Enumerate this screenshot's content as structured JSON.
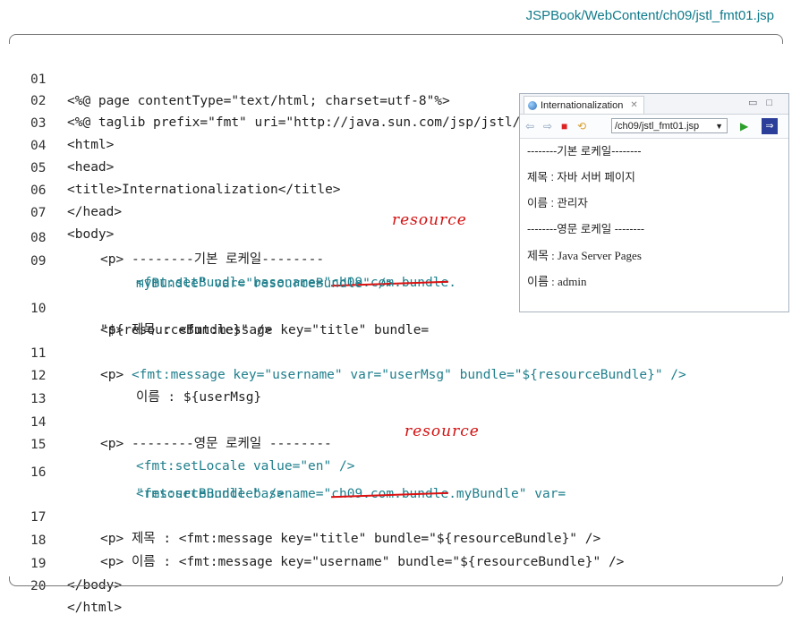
{
  "file_title": "JSPBook/WebContent/ch09/jstl_fmt01.jsp",
  "lines": [
    {
      "num": "01",
      "text": "<%@ page contentType=\"text/html; charset=utf-8\"%>"
    },
    {
      "num": "02",
      "text": "<%@ taglib prefix=\"fmt\" uri=\"http://java.sun.com/jsp/jstl/fmt\"%>"
    },
    {
      "num": "03",
      "text": "<html>"
    },
    {
      "num": "04",
      "text": "<head>"
    },
    {
      "num": "05",
      "text": "<title>Internationalization</title>"
    },
    {
      "num": "06",
      "text": "</head>"
    },
    {
      "num": "07",
      "text": "<body>"
    },
    {
      "num": "08",
      "mark": "<p>",
      "text": "--------기본 로케일--------"
    },
    {
      "num": "09",
      "pre": "<fmt:setBundle basename=\"",
      "strike": "ch09.com.bundle",
      "post": ".",
      "cont": "myBundle\" var=\"resourceBundle\" />"
    },
    {
      "num": "10",
      "mark": "<p>",
      "text": "제목 : <fmt:message key=\"title\" bundle=",
      "cont": "\"${resourceBundle}\" />"
    },
    {
      "num": "11",
      "mark": "<p>",
      "text": "<fmt:message key=\"username\" var=\"userMsg\" bundle=\"${resourceBundle}\" />"
    },
    {
      "num": "12",
      "text": "이름 : ${userMsg}"
    },
    {
      "num": "13",
      "text": ""
    },
    {
      "num": "14",
      "mark": "<p>",
      "text": "--------영문 로케일 --------"
    },
    {
      "num": "15",
      "text": "<fmt:setLocale value=\"en\" />"
    },
    {
      "num": "16",
      "pre": "<fmt:setBundle basename=\"",
      "strike": "ch09.com.bundle",
      "post": ".myBundle\" var=",
      "cont": "\"resourceBundle\" />"
    },
    {
      "num": "17",
      "mark": "<p>",
      "text": "제목 : <fmt:message key=\"title\" bundle=\"${resourceBundle}\" />"
    },
    {
      "num": "18",
      "mark": "<p>",
      "text": "이름 : <fmt:message key=\"username\" bundle=\"${resourceBundle}\" />"
    },
    {
      "num": "19",
      "text": "</body>"
    },
    {
      "num": "20",
      "text": "</html>"
    }
  ],
  "annotations": [
    "resource",
    "resource"
  ],
  "browser": {
    "tab_title": "Internationalization",
    "tab_close": "✕",
    "url": "/ch09/jstl_fmt01.jsp",
    "content": [
      "--------기본 로케일--------",
      "제목 : 자바 서버 페이지",
      "이름 : 관리자",
      "--------영문 로케일 --------",
      "제목 : Java Server Pages",
      "이름 : admin"
    ]
  }
}
